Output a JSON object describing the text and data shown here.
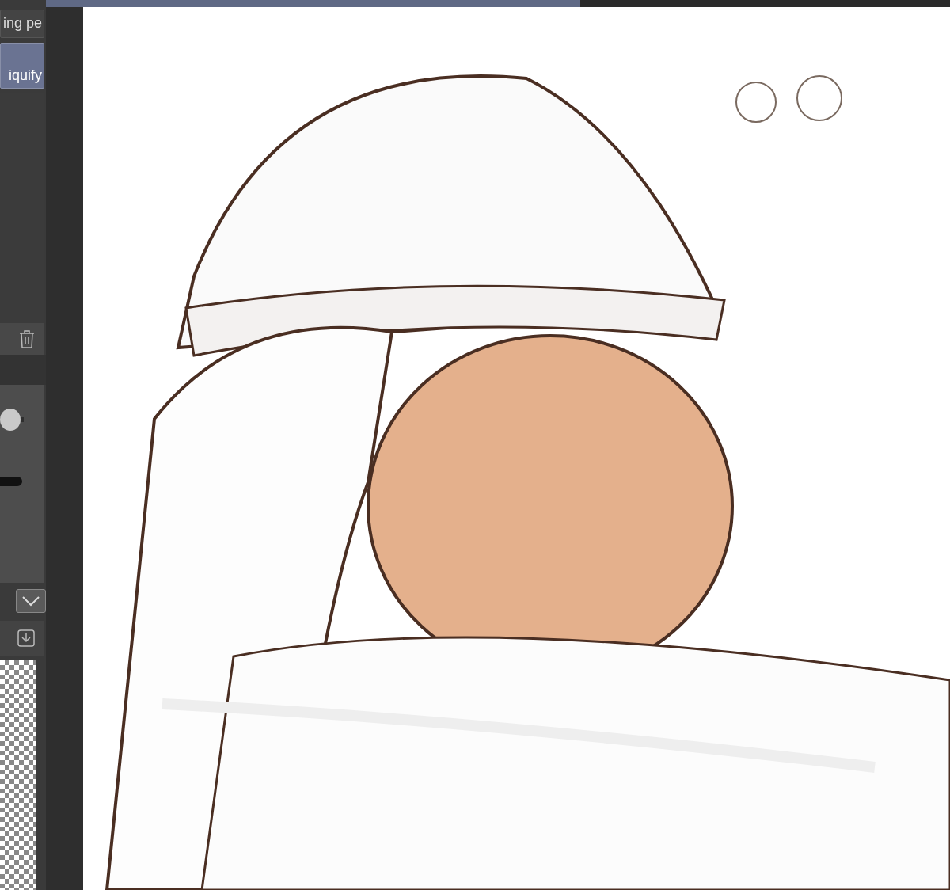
{
  "tool_buttons": [
    {
      "label": "ing pe",
      "selected": false
    },
    {
      "label": "iquify",
      "selected": true
    }
  ],
  "opacity_slider": {
    "level": 0.05
  }
}
